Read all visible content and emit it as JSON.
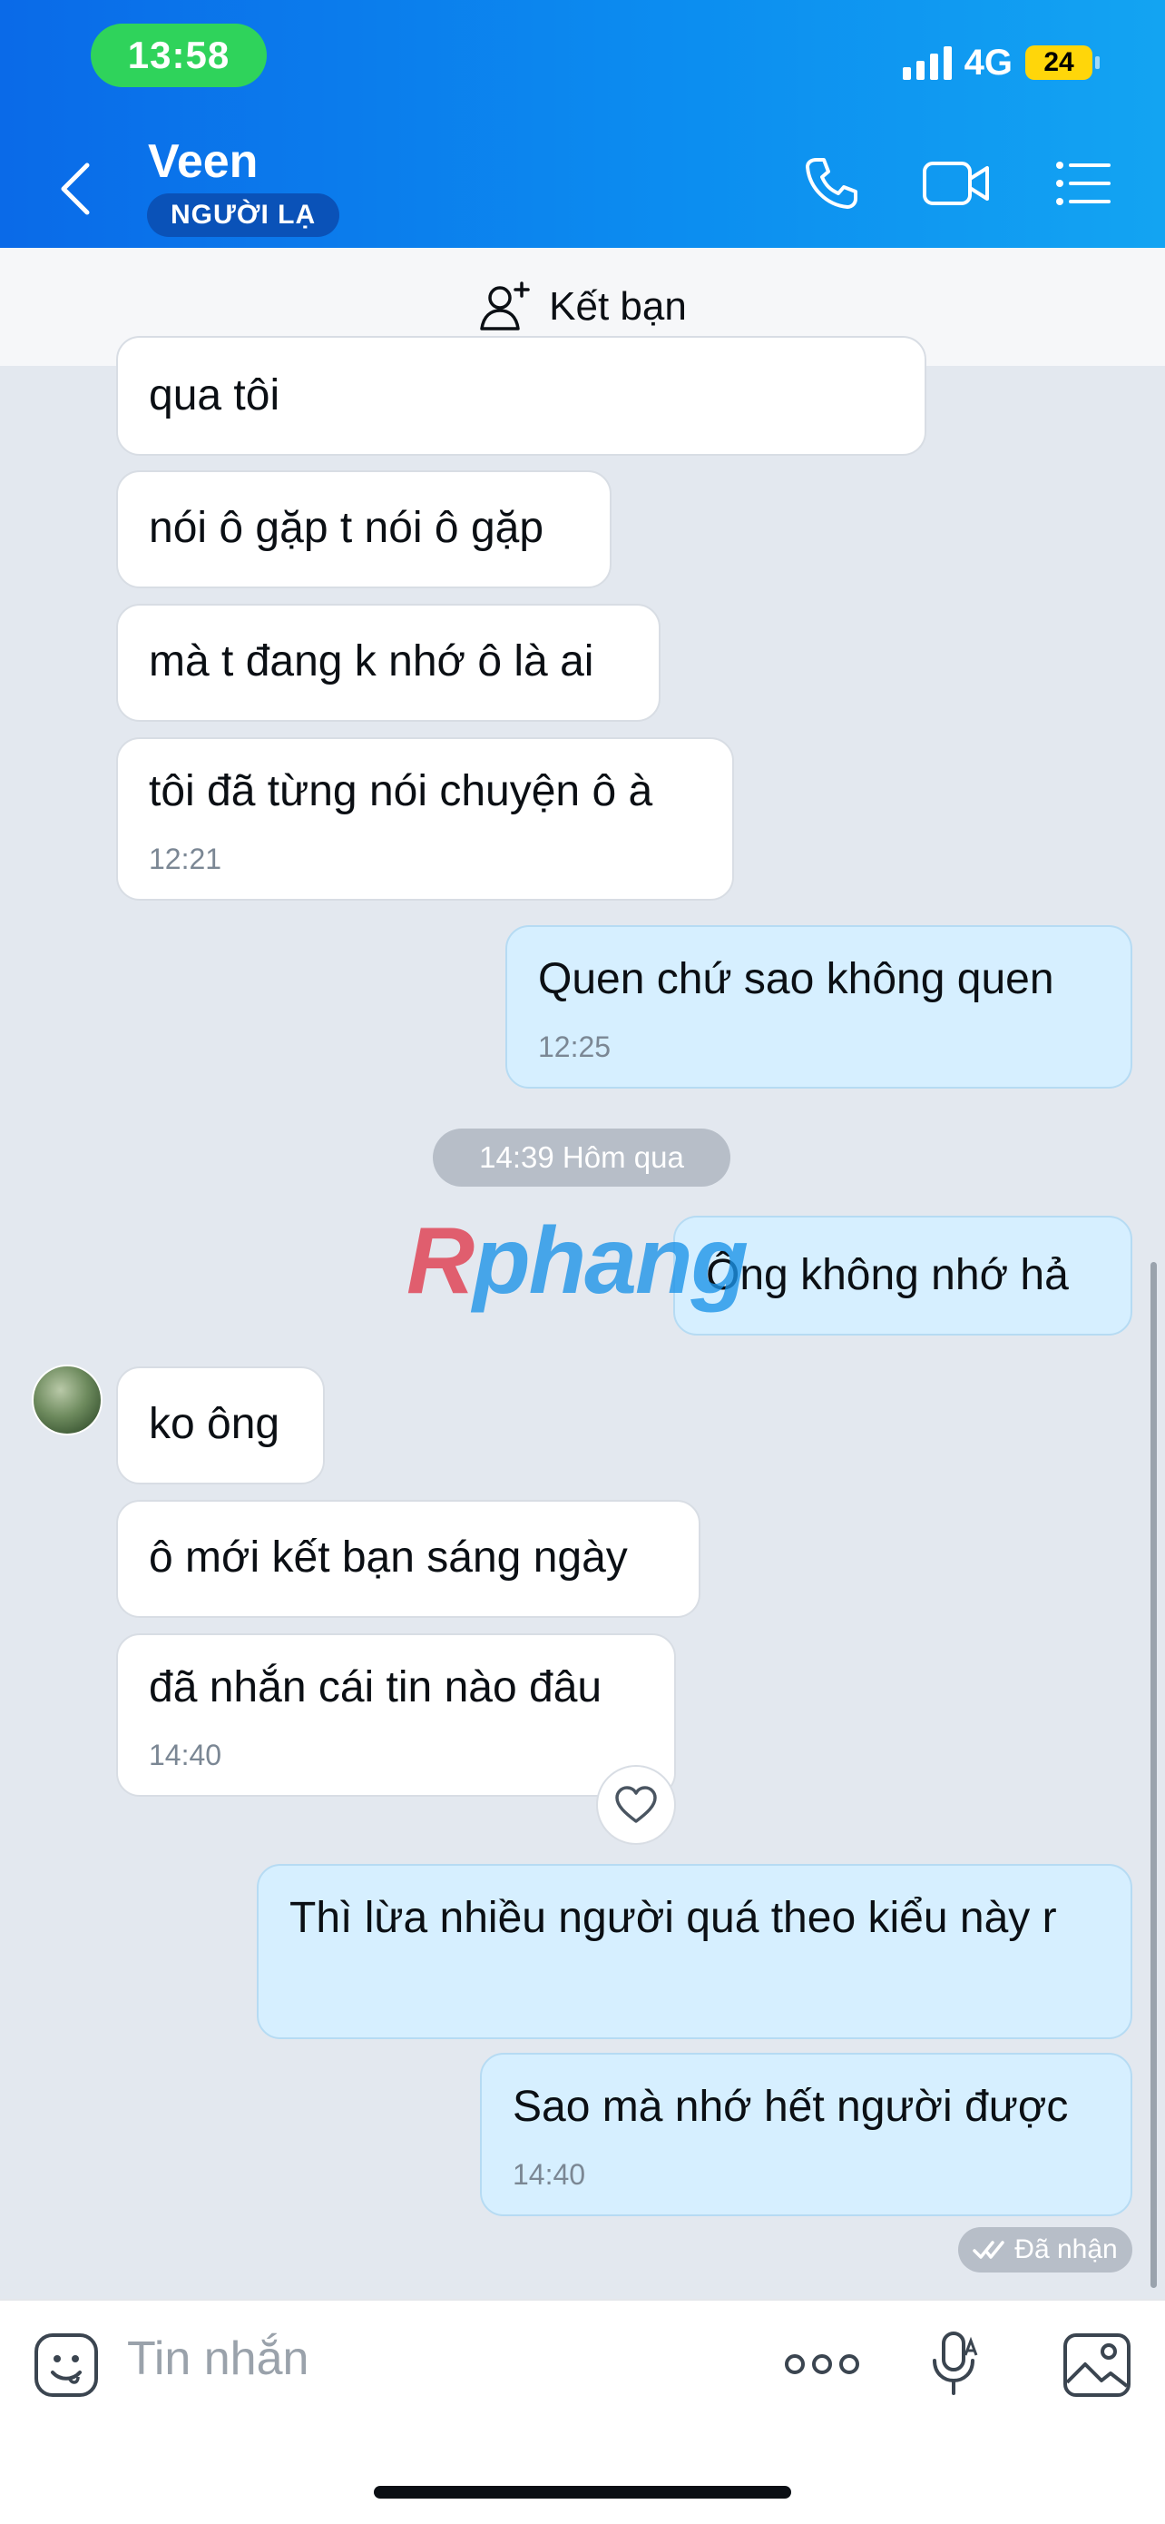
{
  "status_bar": {
    "time": "13:58",
    "network": "4G",
    "battery": "24"
  },
  "header": {
    "contact_name": "Veen",
    "badge": "NGƯỜI LẠ"
  },
  "friend_bar": {
    "label": "Kết bạn"
  },
  "messages": [
    {
      "text": "qua tôi"
    },
    {
      "text": "nói ô gặp t nói ô gặp"
    },
    {
      "text": "mà t đang k nhớ ô là ai"
    },
    {
      "text": "tôi đã từng nói chuyện ô à",
      "time": "12:21"
    },
    {
      "text": "Quen chứ sao không quen",
      "time": "12:25"
    },
    {
      "text": "Ông không nhớ hả"
    },
    {
      "text": "ko ông"
    },
    {
      "text": "ô mới kết bạn sáng ngày"
    },
    {
      "text": "đã nhắn cái tin nào đâu",
      "time": "14:40"
    },
    {
      "text": "Thì lừa nhiều người quá theo kiểu này r"
    },
    {
      "text": "Sao mà nhớ hết người được",
      "time": "14:40"
    }
  ],
  "date_separator": "14:39 Hôm qua",
  "delivery_status": "Đã nhận",
  "watermark": {
    "first": "R",
    "rest": "phang"
  },
  "composer": {
    "placeholder": "Tin nhắn"
  }
}
